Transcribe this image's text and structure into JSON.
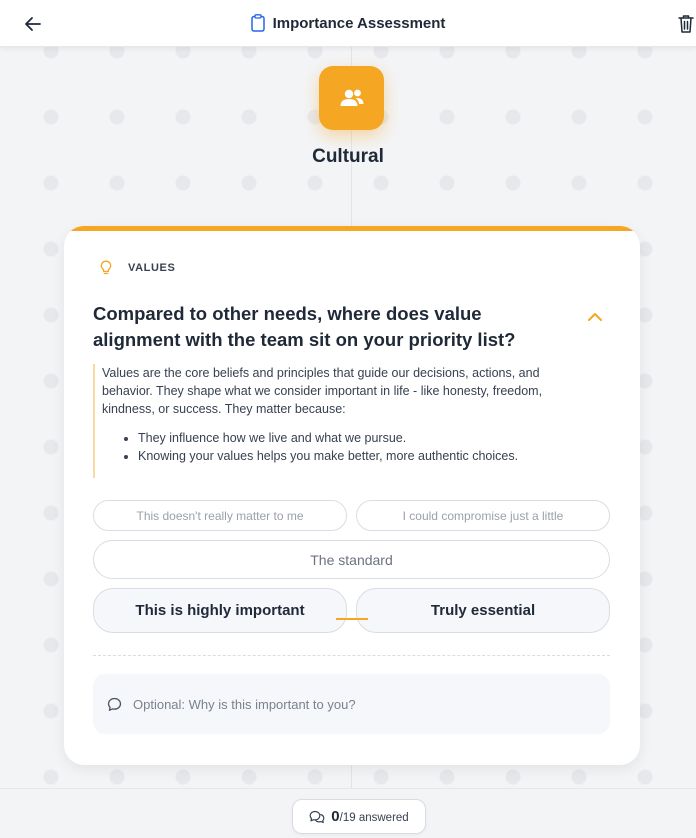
{
  "header": {
    "title": "Importance Assessment",
    "back_icon": "arrow-left-icon",
    "title_icon": "clipboard-icon",
    "delete_icon": "trash-icon"
  },
  "category": {
    "title": "Cultural",
    "icon": "users-icon",
    "accent_color": "#f5a623"
  },
  "question_card": {
    "tag": "VALUES",
    "tag_icon": "lightbulb-icon",
    "question": "Compared to other needs, where does value alignment with the team sit on your priority list?",
    "collapse_icon": "chevron-up-icon",
    "description": "Values are the core beliefs and principles that guide our decisions, actions, and behavior. They shape what we consider important in life - like honesty, freedom, kindness, or success. They matter because:",
    "bullets": [
      "They influence how we live and what we pursue.",
      "Knowing your values helps you make better, more authentic choices."
    ],
    "options": [
      "This doesn't really matter to me",
      "I could compromise just a little",
      "The standard",
      "This is highly important",
      "Truly essential"
    ],
    "note_placeholder": "Optional: Why is this important to you?",
    "note_icon": "chat-bubble-icon"
  },
  "footer": {
    "answered_count": "0",
    "answered_total": "/19 answered",
    "progress_icon": "chat-bubbles-icon"
  }
}
